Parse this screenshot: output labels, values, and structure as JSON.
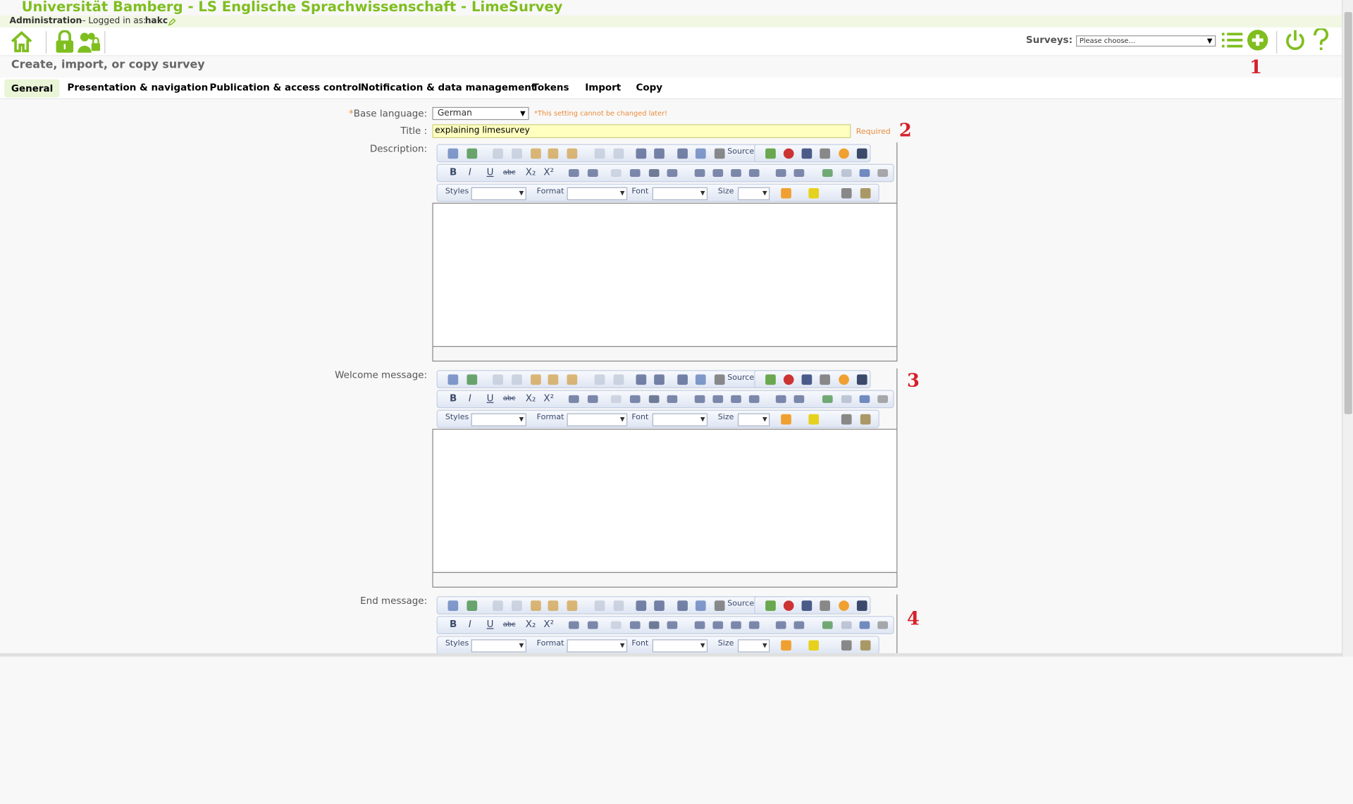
{
  "app": {
    "title": "Universität Bamberg - LS Englische Sprachwissenschaft - LimeSurvey",
    "admin_label": "Administration",
    "logged_in_label": "-- Logged in as:",
    "username": "hakc"
  },
  "toolbar": {
    "surveys_label": "Surveys:",
    "surveys_placeholder": "Please choose..."
  },
  "page": {
    "heading": "Create, import, or copy survey"
  },
  "tabs": [
    {
      "label": "General"
    },
    {
      "label": "Presentation & navigation"
    },
    {
      "label": "Publication & access control"
    },
    {
      "label": "Notification & data management"
    },
    {
      "label": "Tokens"
    },
    {
      "label": "Import"
    },
    {
      "label": "Copy"
    }
  ],
  "form": {
    "base_language": {
      "required_mark": "*",
      "label": "Base language:",
      "value": "German",
      "note": "*This setting cannot be changed later!"
    },
    "title": {
      "label": "Title :",
      "value": "explaining limesurvey",
      "note": "Required"
    },
    "description": {
      "label": "Description:"
    },
    "welcome": {
      "label": "Welcome message:"
    },
    "end": {
      "label": "End message:"
    }
  },
  "editor": {
    "source_label": "Source",
    "styles_label": "Styles",
    "format_label": "Format",
    "font_label": "Font",
    "size_label": "Size"
  },
  "annotations": [
    "1",
    "2",
    "3",
    "4"
  ],
  "colors": {
    "brand": "#7fbe1f",
    "marker": "#d6202b",
    "note": "#e88d3d",
    "title_bg": "#ffffc0"
  }
}
